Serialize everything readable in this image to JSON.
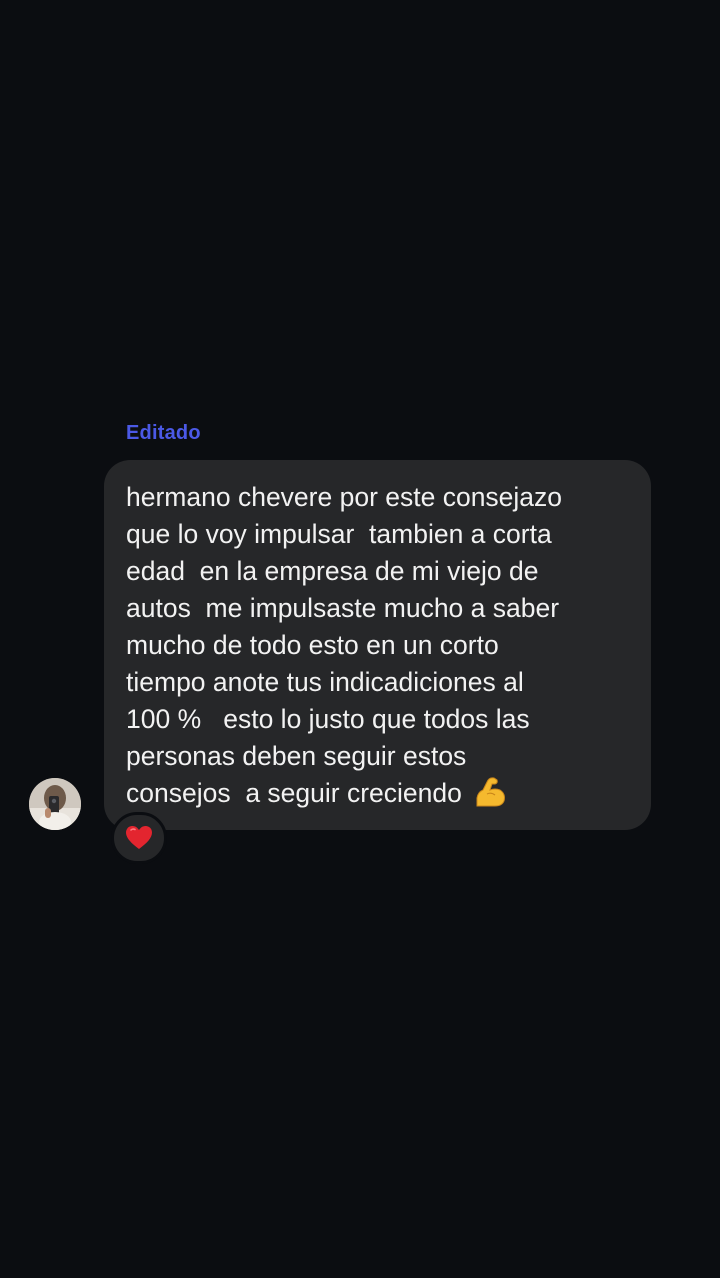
{
  "message": {
    "edited_label": "Editado",
    "text": "hermano chevere por este consejazo\nque lo voy impulsar  tambien a corta\nedad  en la empresa de mi viejo de\nautos  me impulsaste mucho a saber\nmucho de todo esto en un corto\ntiempo anote tus indicadiciones al\n100 %   esto lo justo que todos las\npersonas deben seguir estos\nconsejos  a seguir creciendo ",
    "trailing_emoji_icon": "flexed-biceps-icon",
    "reaction_icon": "red-heart-icon"
  },
  "colors": {
    "background": "#0b0d11",
    "bubble": "#262729",
    "edited_accent": "#4b59e6",
    "text": "#f2f2f2"
  }
}
